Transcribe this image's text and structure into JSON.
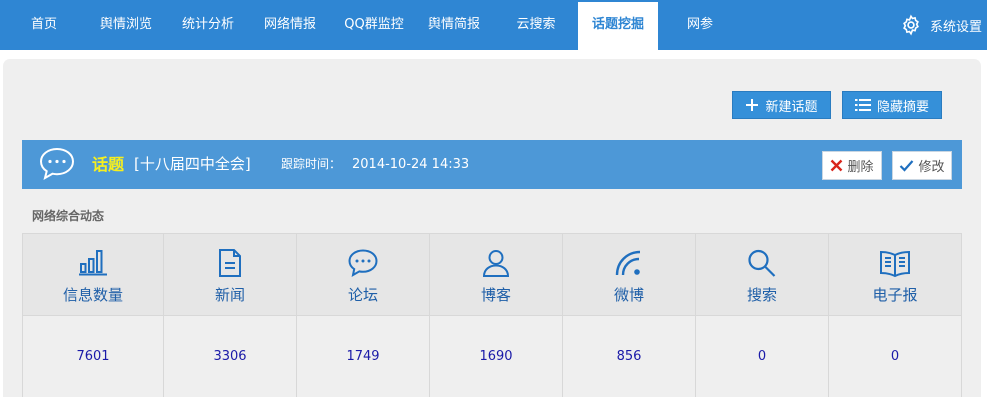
{
  "nav": {
    "items": [
      {
        "label": "首页"
      },
      {
        "label": "舆情浏览"
      },
      {
        "label": "统计分析"
      },
      {
        "label": "网络情报"
      },
      {
        "label": "QQ群监控"
      },
      {
        "label": "舆情简报"
      },
      {
        "label": "云搜索"
      },
      {
        "label": "话题挖掘"
      },
      {
        "label": "网参"
      }
    ],
    "active": "话题挖掘",
    "settings_label": "系统设置"
  },
  "toolbar": {
    "new_topic_label": "新建话题",
    "hide_summary_label": "隐藏摘要"
  },
  "topic": {
    "prefix": "话题",
    "name": "[十八届四中全会]",
    "time_label": "跟踪时间：",
    "time_value": "2014-10-24 14:33",
    "delete_label": "删除",
    "edit_label": "修改"
  },
  "section_title": "网络综合动态",
  "stats": [
    {
      "label": "信息数量",
      "icon": "bar-chart-icon",
      "value": "7601"
    },
    {
      "label": "新闻",
      "icon": "document-icon",
      "value": "3306"
    },
    {
      "label": "论坛",
      "icon": "chat-bubble-icon",
      "value": "1749"
    },
    {
      "label": "博客",
      "icon": "user-icon",
      "value": "1690"
    },
    {
      "label": "微博",
      "icon": "rss-icon",
      "value": "856"
    },
    {
      "label": "搜索",
      "icon": "search-icon",
      "value": "0"
    },
    {
      "label": "电子报",
      "icon": "newspaper-icon",
      "value": "0"
    }
  ],
  "colors": {
    "nav_bg": "#2f86d3",
    "topic_bar": "#4d98d7",
    "topic_highlight": "#f7ef1e",
    "stat_label": "#1f5fa8",
    "stat_value": "#1a1aa8",
    "delete_x": "#d9241b"
  }
}
